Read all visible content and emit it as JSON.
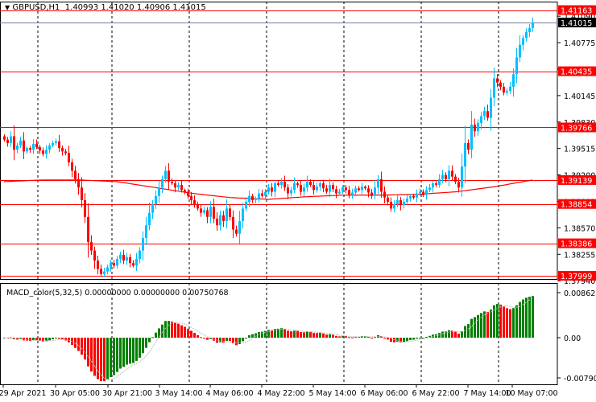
{
  "header": {
    "symbol_label": "GBPUSD,H1",
    "ohlc_label": "1.40993 1.41020 1.40906 1.41015",
    "menu_icon": "triangle-down-icon"
  },
  "indicator": {
    "label": "MACD_color(5,32,5) 0.00000000 0.00000000 0.00750768"
  },
  "colors": {
    "bull": "#00bfff",
    "bear": "#ff0000",
    "level_line": "#ff0000",
    "ma_line": "#ff0000",
    "macd_up": "#008000",
    "macd_down": "#ff0000",
    "price_line": "#708090"
  },
  "chart_data": {
    "type": "candlestick",
    "symbol": "GBPUSD",
    "timeframe": "H1",
    "ylim": [
      1.3794,
      1.4124
    ],
    "current_price": "1.41015",
    "price_ticks": [
      "1.41090",
      "1.40775",
      "1.40460",
      "1.40145",
      "1.39830",
      "1.39515",
      "1.39200",
      "1.38885",
      "1.38570",
      "1.38255",
      "1.37940"
    ],
    "levels": [
      "1.41163",
      "1.40435",
      "1.39766",
      "1.39139",
      "1.38854",
      "1.38386",
      "1.37999"
    ],
    "time_labels": [
      "29 Apr 2021",
      "30 Apr 05:00",
      "30 Apr 21:00",
      "3 May 14:00",
      "4 May 06:00",
      "4 May 22:00",
      "5 May 14:00",
      "6 May 06:00",
      "6 May 22:00",
      "7 May 14:00",
      "10 May 07:00"
    ],
    "closes": [
      1.3962,
      1.3958,
      1.3966,
      1.395,
      1.3955,
      1.3961,
      1.3948,
      1.3952,
      1.395,
      1.3957,
      1.3953,
      1.3949,
      1.3945,
      1.395,
      1.3955,
      1.3958,
      1.396,
      1.3952,
      1.3948,
      1.3946,
      1.3935,
      1.3925,
      1.3915,
      1.3905,
      1.389,
      1.387,
      1.384,
      1.383,
      1.3818,
      1.3808,
      1.3802,
      1.3805,
      1.381,
      1.3815,
      1.3812,
      1.382,
      1.3825,
      1.3818,
      1.3822,
      1.3815,
      1.3812,
      1.382,
      1.383,
      1.3845,
      1.386,
      1.3875,
      1.3885,
      1.3895,
      1.3905,
      1.3915,
      1.3925,
      1.3912,
      1.391,
      1.3905,
      1.3908,
      1.3902,
      1.39,
      1.3895,
      1.389,
      1.3885,
      1.388,
      1.3875,
      1.3878,
      1.387,
      1.3882,
      1.3868,
      1.386,
      1.3872,
      1.3865,
      1.388,
      1.387,
      1.3855,
      1.385,
      1.3865,
      1.388,
      1.3888,
      1.3895,
      1.389,
      1.3892,
      1.3898,
      1.3895,
      1.39,
      1.3905,
      1.39,
      1.391,
      1.3908,
      1.3912,
      1.3905,
      1.3898,
      1.3902,
      1.391,
      1.3908,
      1.39,
      1.3905,
      1.3912,
      1.3908,
      1.3902,
      1.3906,
      1.391,
      1.3904,
      1.39,
      1.3908,
      1.3903,
      1.3898,
      1.39,
      1.3905,
      1.3902,
      1.3896,
      1.3899,
      1.3904,
      1.3902,
      1.3906,
      1.3904,
      1.3899,
      1.3895,
      1.3905,
      1.3915,
      1.39,
      1.3893,
      1.3888,
      1.388,
      1.3885,
      1.389,
      1.3884,
      1.3888,
      1.3892,
      1.3895,
      1.3893,
      1.3898,
      1.39,
      1.3896,
      1.3902,
      1.3905,
      1.391,
      1.3908,
      1.3915,
      1.392,
      1.3915,
      1.3925,
      1.3918,
      1.3912,
      1.3905,
      1.393,
      1.3958,
      1.395,
      1.398,
      1.3972,
      1.3982,
      1.399,
      1.3996,
      1.3988,
      1.4012,
      1.4035,
      1.403,
      1.4025,
      1.4018,
      1.402,
      1.4025,
      1.404,
      1.406,
      1.4075,
      1.4083,
      1.409,
      1.4095,
      1.4101
    ],
    "ma_keypoints": [
      1.3912,
      1.3914,
      1.3914,
      1.3912,
      1.3905,
      1.3898,
      1.3893,
      1.3891,
      1.3894,
      1.3896,
      1.3896,
      1.3897,
      1.39,
      1.3906,
      1.3914
    ],
    "macd": {
      "fast": 5,
      "slow": 32,
      "signal": 5,
      "ylim": [
        -0.0079046,
        0.0086289
      ],
      "ticks": [
        "0.0086289",
        "0.00",
        "-0.0079046"
      ]
    }
  }
}
